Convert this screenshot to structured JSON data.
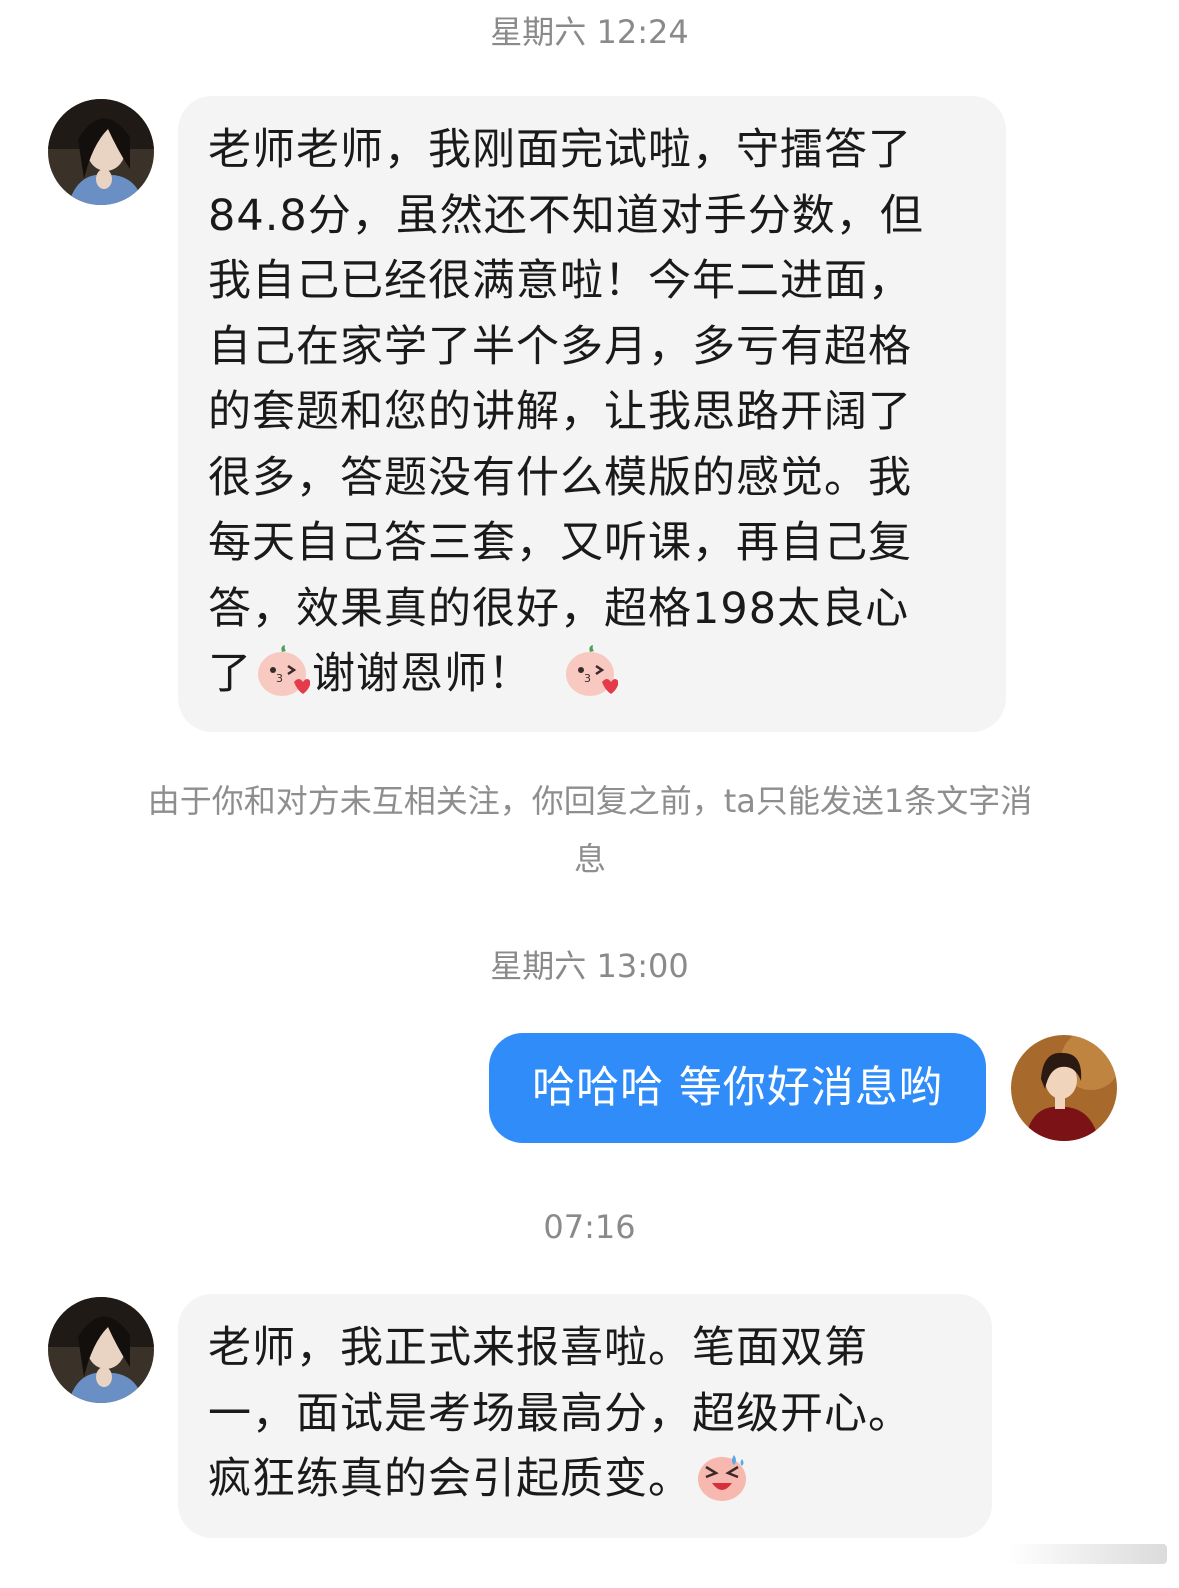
{
  "conversation": {
    "timestamps": [
      "星期六 12:24",
      "星期六 13:00",
      "07:16"
    ],
    "message1": {
      "lines": [
        "老师老师，我刚面完试啦，守擂答了",
        "84.8分，虽然还不知道对手分数，但",
        "我自己已经很满意啦！今年二进面，",
        "自己在家学了半个多月，多亏有超格",
        "的套题和您的讲解，让我思路开阔了",
        "很多，答题没有什么模版的感觉。我",
        "每天自己答三套，又听课，再自己复",
        "答，效果真的很好，超格198太良心"
      ],
      "last_line_prefix": "了",
      "last_line_middle": "谢谢恩师！",
      "emoji": "kiss-emoji"
    },
    "notice": {
      "line1": "由于你和对方未互相关注，你回复之前，ta只能发送1条文字消",
      "line2": "息"
    },
    "reply": {
      "text": "哈哈哈 等你好消息哟"
    },
    "message2": {
      "lines": [
        "老师，我正式来报喜啦。笔面双第",
        "一，面试是考场最高分，超级开心。"
      ],
      "last_line": "疯狂练真的会引起质变。",
      "emoji": "laughing-emoji"
    }
  },
  "colors": {
    "outgoing_bubble": "#2f8cf8",
    "incoming_bubble": "#f4f4f4",
    "timestamp_text": "#8a8a8a"
  }
}
